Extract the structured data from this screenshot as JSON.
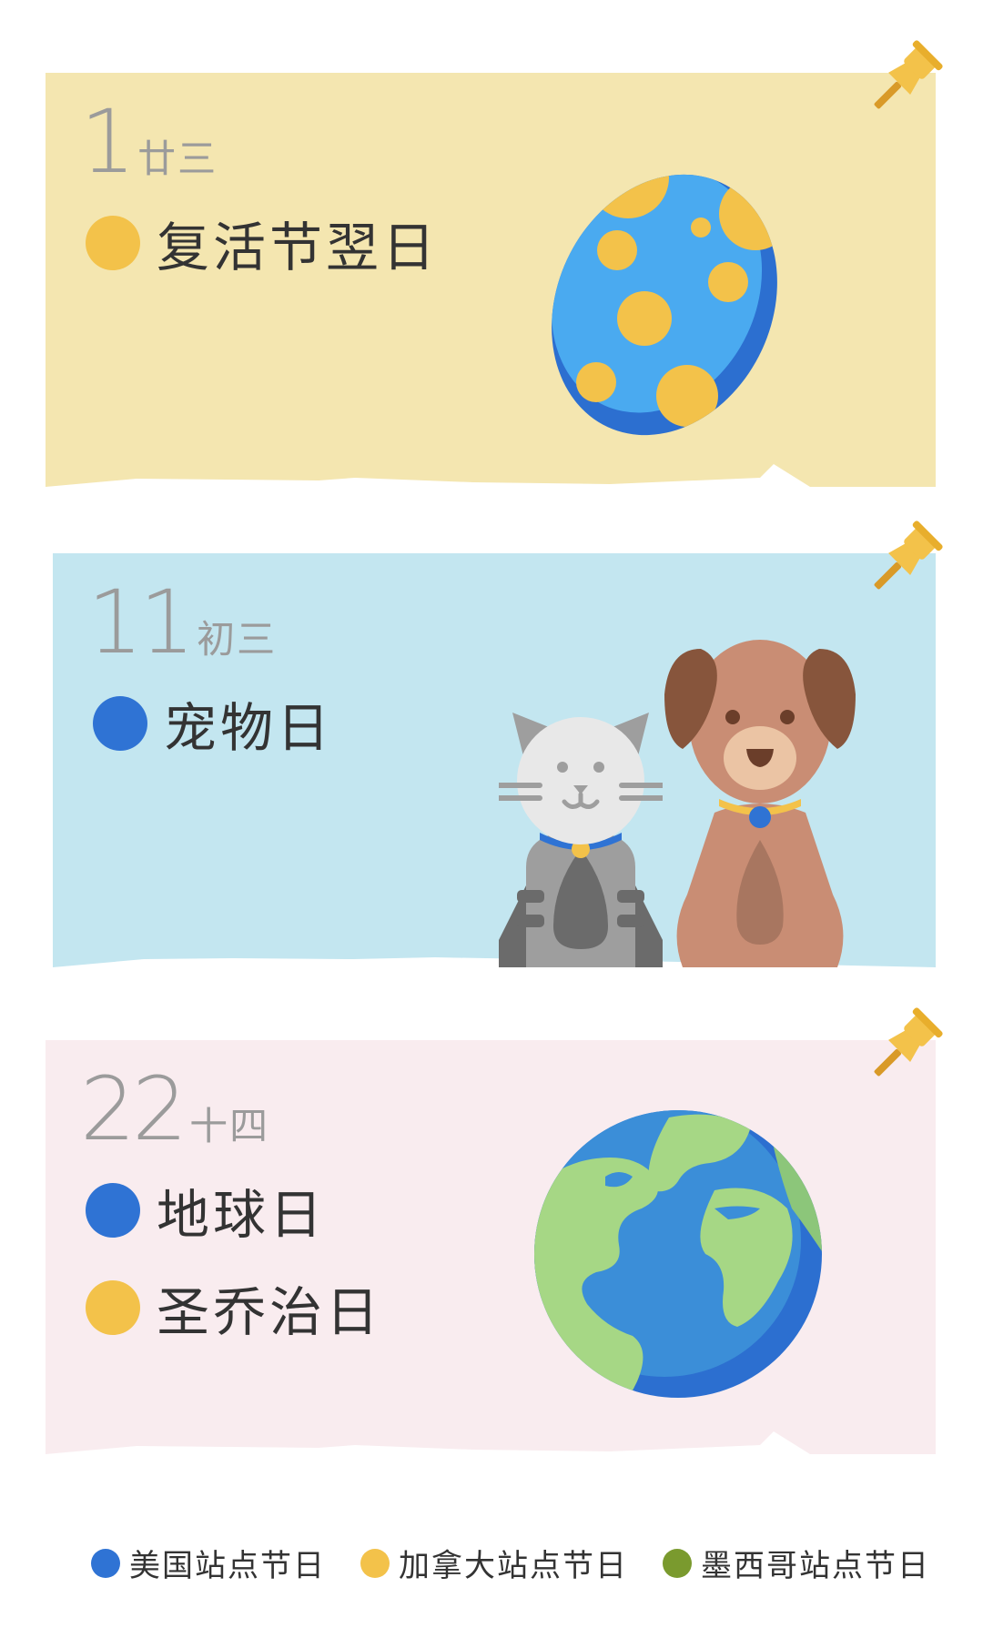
{
  "colors": {
    "us": "#2f73d4",
    "canada": "#f3c24a",
    "mexico": "#7a9a2e",
    "card_yellow": "#f4e6b0",
    "card_blue": "#c3e6f0",
    "card_pink": "#f9ecef"
  },
  "cards": [
    {
      "day": "1",
      "lunar": "廿三",
      "holidays": [
        {
          "name": "复活节翌日",
          "color": "#f3c24a"
        }
      ],
      "illustration": "easter-egg-icon"
    },
    {
      "day": "11",
      "lunar": "初三",
      "holidays": [
        {
          "name": "宠物日",
          "color": "#2f73d4"
        }
      ],
      "illustration": "cat-and-dog-icon"
    },
    {
      "day": "22",
      "lunar": "十四",
      "holidays": [
        {
          "name": "地球日",
          "color": "#2f73d4"
        },
        {
          "name": "圣乔治日",
          "color": "#f3c24a"
        }
      ],
      "illustration": "earth-globe-icon"
    }
  ],
  "legend": [
    {
      "label": "美国站点节日",
      "color": "#2f73d4"
    },
    {
      "label": "加拿大站点节日",
      "color": "#f3c24a"
    },
    {
      "label": "墨西哥站点节日",
      "color": "#7a9a2e"
    }
  ],
  "icons": [
    "pushpin-icon",
    "easter-egg-icon",
    "cat-icon",
    "dog-icon",
    "earth-globe-icon"
  ]
}
